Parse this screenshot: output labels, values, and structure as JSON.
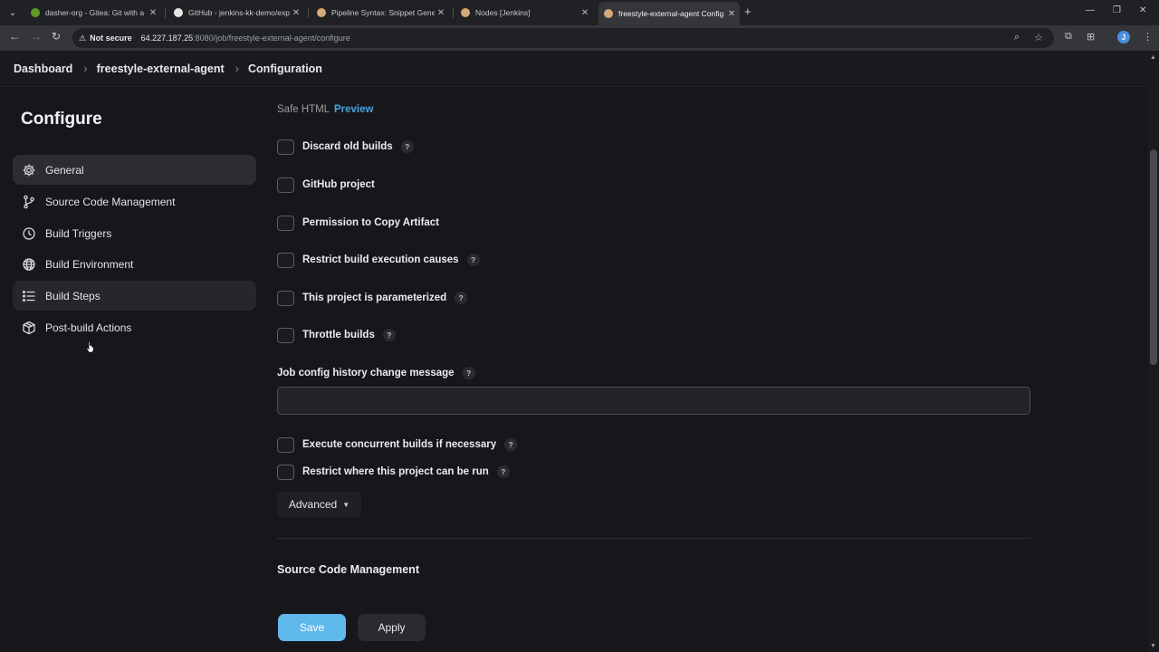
{
  "browser": {
    "tabs": [
      {
        "title": "dasher-org - Gitea: Git with a cu",
        "favicon_color": "#609926"
      },
      {
        "title": "GitHub - jenkins-kk-demo/expl",
        "favicon_color": "#e6e6e6"
      },
      {
        "title": "Pipeline Syntax: Snippet Genera",
        "favicon_color": "#d6a77a"
      },
      {
        "title": "Nodes [Jenkins]",
        "favicon_color": "#d6a77a"
      },
      {
        "title": "freestyle-external-agent Config",
        "favicon_color": "#d6a77a"
      }
    ],
    "not_secure_label": "Not secure",
    "url_host": "64.227.187.25",
    "url_rest": ":8080/job/freestyle-external-agent/configure",
    "profile_initial": "J"
  },
  "breadcrumb": {
    "items": [
      "Dashboard",
      "freestyle-external-agent",
      "Configuration"
    ]
  },
  "sidebar": {
    "title": "Configure",
    "items": [
      {
        "label": "General",
        "icon": "gear-icon"
      },
      {
        "label": "Source Code Management",
        "icon": "branch-icon"
      },
      {
        "label": "Build Triggers",
        "icon": "clock-icon"
      },
      {
        "label": "Build Environment",
        "icon": "globe-icon"
      },
      {
        "label": "Build Steps",
        "icon": "list-icon"
      },
      {
        "label": "Post-build Actions",
        "icon": "package-icon"
      }
    ]
  },
  "main": {
    "safe_html_label": "Safe HTML",
    "preview_label": "Preview",
    "options": [
      {
        "label": "Discard old builds",
        "help": "?"
      },
      {
        "label": "GitHub project"
      },
      {
        "label": "Permission to Copy Artifact"
      },
      {
        "label": "Restrict build execution causes",
        "help": "?"
      },
      {
        "label": "This project is parameterized",
        "help": "?"
      },
      {
        "label": "Throttle builds",
        "help": "?"
      }
    ],
    "history_label": "Job config history change message",
    "history_help": "?",
    "history_value": "",
    "options2": [
      {
        "label": "Execute concurrent builds if necessary",
        "help": "?"
      },
      {
        "label": "Restrict where this project can be run",
        "help": "?"
      }
    ],
    "advanced_label": "Advanced",
    "section_title": "Source Code Management",
    "save_label": "Save",
    "apply_label": "Apply"
  }
}
